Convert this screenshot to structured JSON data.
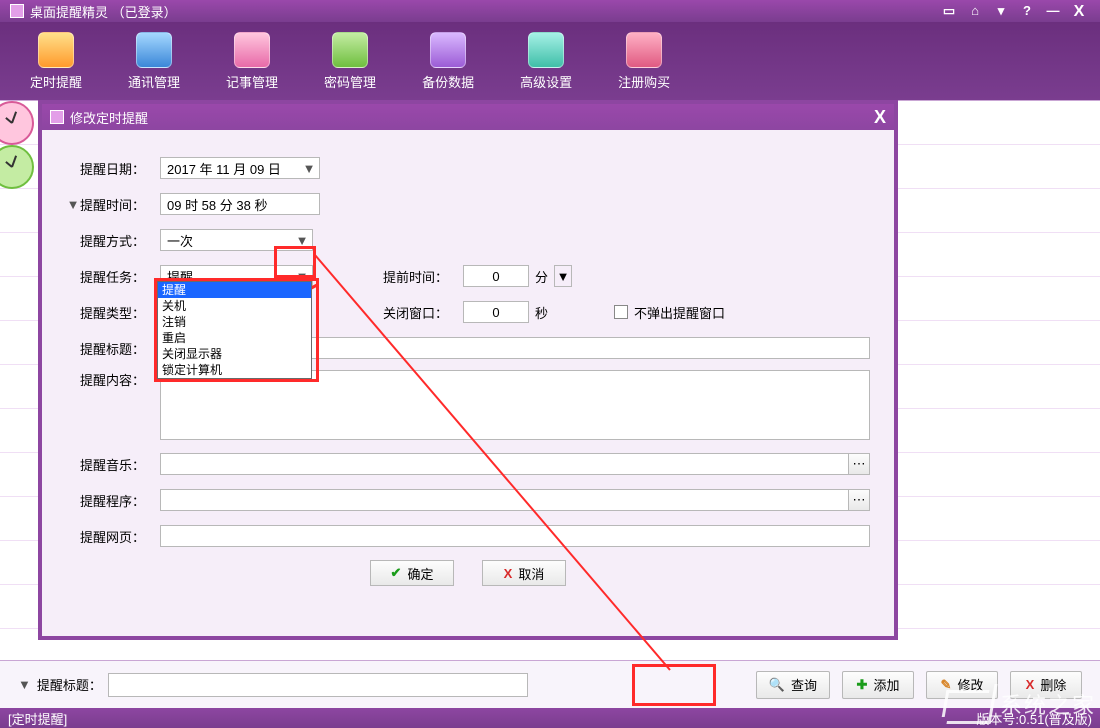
{
  "window": {
    "title": "桌面提醒精灵 （已登录）"
  },
  "toolbar": {
    "items": [
      {
        "label": "定时提醒",
        "iconClass": "ic-orange"
      },
      {
        "label": "通讯管理",
        "iconClass": "ic-blue"
      },
      {
        "label": "记事管理",
        "iconClass": "ic-pink"
      },
      {
        "label": "密码管理",
        "iconClass": "ic-green"
      },
      {
        "label": "备份数据",
        "iconClass": "ic-purple"
      },
      {
        "label": "高级设置",
        "iconClass": "ic-cyan"
      },
      {
        "label": "注册购买",
        "iconClass": "ic-rose"
      }
    ]
  },
  "dialog": {
    "title": "修改定时提醒",
    "labels": {
      "date": "提醒日期：",
      "time": "提醒时间：",
      "mode": "提醒方式：",
      "task": "提醒任务：",
      "type": "提醒类型：",
      "title": "提醒标题：",
      "content": "提醒内容：",
      "music": "提醒音乐：",
      "program": "提醒程序：",
      "url": "提醒网页：",
      "advance": "提前时间：",
      "close": "关闭窗口：",
      "advance_unit": "分",
      "close_unit": "秒",
      "no_popup": "不弹出提醒窗口"
    },
    "values": {
      "date": "2017 年 11 月 09 日",
      "time": "09 时 58 分 38 秒",
      "mode": "一次",
      "task": "提醒",
      "advance": "0",
      "close": "0"
    },
    "dropdown_options": [
      "提醒",
      "关机",
      "注销",
      "重启",
      "关闭显示器",
      "锁定计算机"
    ],
    "buttons": {
      "ok": "确定",
      "cancel": "取消"
    }
  },
  "bottom": {
    "filter_label": "提醒标题：",
    "buttons": {
      "query": "查询",
      "add": "添加",
      "edit": "修改",
      "delete": "删除"
    }
  },
  "status": {
    "tab": "[定时提醒]",
    "version": "版本号:0.51(普及版)"
  },
  "watermark": "系统之家"
}
